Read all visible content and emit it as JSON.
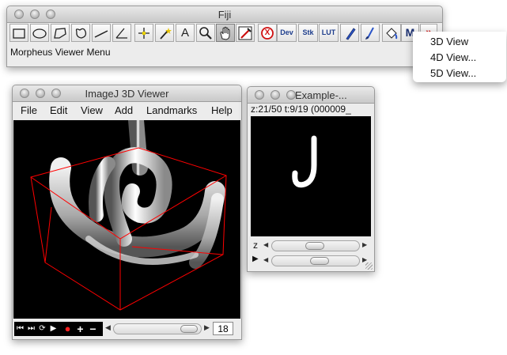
{
  "fiji": {
    "title": "Fiji",
    "status": "Morpheus Viewer Menu",
    "tools": [
      {
        "name": "rectangle-tool-icon",
        "label": ""
      },
      {
        "name": "oval-tool-icon",
        "label": ""
      },
      {
        "name": "polygon-tool-icon",
        "label": ""
      },
      {
        "name": "freehand-tool-icon",
        "label": ""
      },
      {
        "name": "line-tool-icon",
        "label": ""
      },
      {
        "name": "angle-tool-icon",
        "label": ""
      },
      {
        "name": "point-tool-icon",
        "label": ""
      },
      {
        "name": "wand-tool-icon",
        "label": ""
      },
      {
        "name": "text-tool-icon",
        "label": "A"
      },
      {
        "name": "magnifier-tool-icon",
        "label": ""
      },
      {
        "name": "hand-tool-icon",
        "label": ""
      },
      {
        "name": "color-picker-tool-icon",
        "label": ""
      },
      {
        "name": "stop-tool-icon",
        "label": "X"
      },
      {
        "name": "dev-tool-icon",
        "label": "Dev"
      },
      {
        "name": "stacks-tool-icon",
        "label": "Stk"
      },
      {
        "name": "lut-tool-icon",
        "label": "LUT"
      },
      {
        "name": "pencil-tool-icon",
        "label": ""
      },
      {
        "name": "brush-tool-icon",
        "label": ""
      },
      {
        "name": "flood-fill-tool-icon",
        "label": ""
      },
      {
        "name": "morpheus-tool-icon",
        "label": "M"
      },
      {
        "name": "more-tools-icon",
        "label": "»"
      }
    ]
  },
  "popup_menu": {
    "items": [
      "3D View",
      "4D View...",
      "5D View..."
    ]
  },
  "viewer3d": {
    "title": "ImageJ 3D Viewer",
    "menu": [
      "File",
      "Edit",
      "View",
      "Add",
      "Landmarks",
      "Help"
    ],
    "frame_value": "18"
  },
  "example": {
    "title": "Example-...",
    "info": "z:21/50 t:9/19 (000009_",
    "z_label": "z",
    "t_label": "▶"
  },
  "colors": {
    "bounding_box": "#ff0000",
    "canvas": "#000000"
  }
}
